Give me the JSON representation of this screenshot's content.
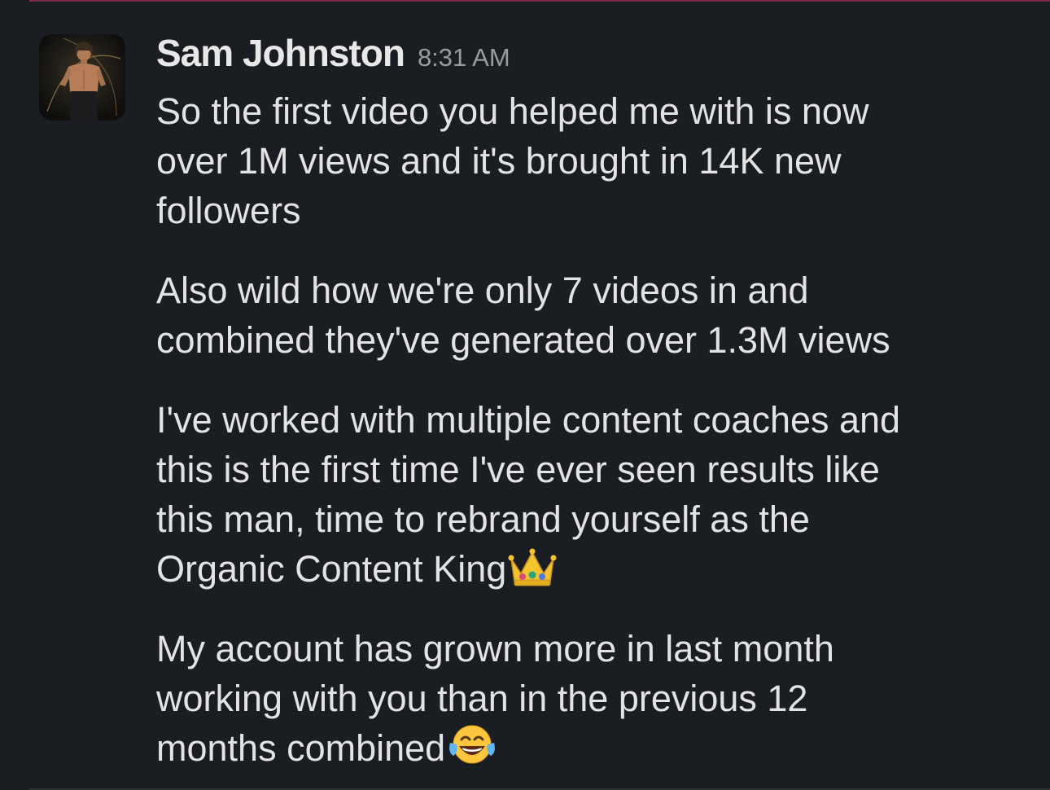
{
  "message": {
    "sender": "Sam Johnston",
    "timestamp": "8:31 AM",
    "avatar_icon": "avatar-photo",
    "paragraphs": [
      {
        "lines": [
          "So the first video you helped me with is now",
          "over 1M views and it's brought in 14K new",
          "followers"
        ]
      },
      {
        "lines": [
          "Also wild how we're only 7 videos in and",
          "combined they've generated over 1.3M views"
        ]
      },
      {
        "lines": [
          "I've worked with multiple content coaches and",
          "this is the first time I've ever seen results like",
          "this man, time to rebrand yourself as the",
          "Organic Content King"
        ],
        "trailing_emoji": "crown-emoji"
      },
      {
        "lines": [
          "My account has grown more in last month",
          "working with you than in the previous 12",
          "months combined"
        ],
        "trailing_emoji": "tears-of-joy-emoji"
      }
    ]
  },
  "colors": {
    "background": "#1a1d21",
    "text": "#e3e3e3",
    "sender": "#e8e8e8",
    "timestamp": "#9a9b9d",
    "top_divider": "#7a2d4f"
  }
}
